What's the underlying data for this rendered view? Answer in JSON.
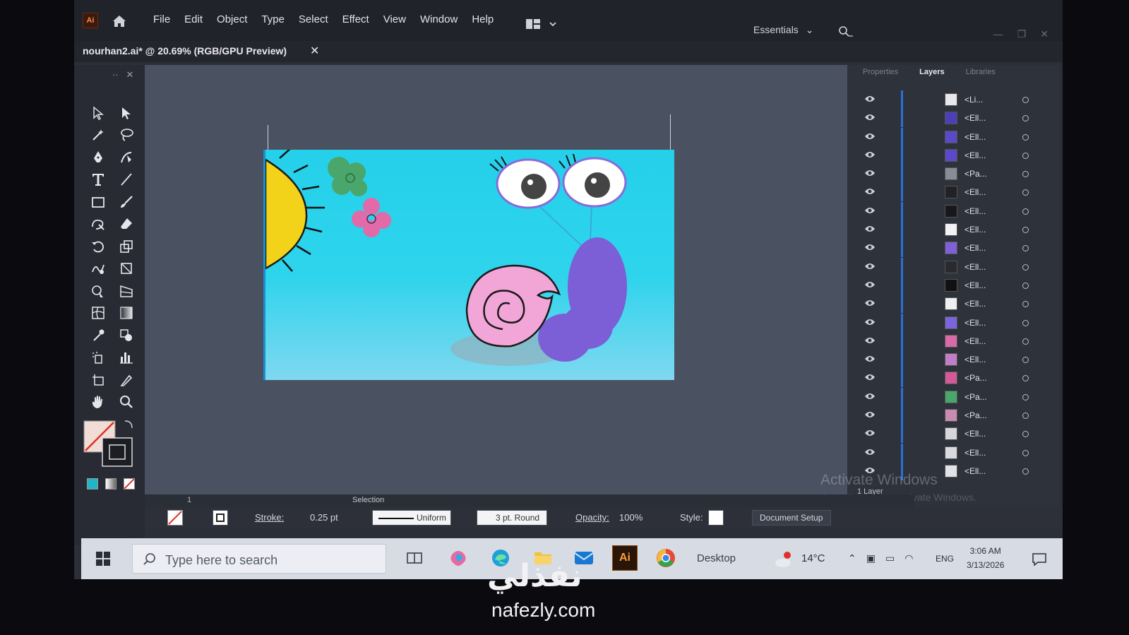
{
  "app": {
    "logo_text": "Ai",
    "menu": [
      "File",
      "Edit",
      "Object",
      "Type",
      "Select",
      "Effect",
      "View",
      "Window",
      "Help"
    ],
    "workspace": "Essentials"
  },
  "document": {
    "tab_title": "nourhan2.ai* @ 20.69% (RGB/GPU Preview)",
    "close_glyph": "✕"
  },
  "panel": {
    "tabs": [
      "Properties",
      "Layers",
      "Libraries"
    ],
    "active_tab": "Layers",
    "layers": [
      {
        "name": "<Li...",
        "thumb": "#e8e8ec"
      },
      {
        "name": "<Ell...",
        "thumb": "#4b3fb8"
      },
      {
        "name": "<Ell...",
        "thumb": "#5b49c9"
      },
      {
        "name": "<Ell...",
        "thumb": "#5b49c9"
      },
      {
        "name": "<Pa...",
        "thumb": "#888c96"
      },
      {
        "name": "<Ell...",
        "thumb": "#222226"
      },
      {
        "name": "<Ell...",
        "thumb": "#18181c"
      },
      {
        "name": "<Ell...",
        "thumb": "#f2f2f4"
      },
      {
        "name": "<Ell...",
        "thumb": "#8060d6"
      },
      {
        "name": "<Ell...",
        "thumb": "#2a2a2e"
      },
      {
        "name": "<Ell...",
        "thumb": "#111114"
      },
      {
        "name": "<Ell...",
        "thumb": "#f0f0f2"
      },
      {
        "name": "<Ell...",
        "thumb": "#7a66dc"
      },
      {
        "name": "<Ell...",
        "thumb": "#d96aa8"
      },
      {
        "name": "<Ell...",
        "thumb": "#c07ec6"
      },
      {
        "name": "<Pa...",
        "thumb": "#d35a98"
      },
      {
        "name": "<Pa...",
        "thumb": "#4aa66a"
      },
      {
        "name": "<Pa...",
        "thumb": "#c78cb0"
      },
      {
        "name": "<Ell...",
        "thumb": "#d6d6da"
      },
      {
        "name": "<Ell...",
        "thumb": "#dadade"
      },
      {
        "name": "<Ell...",
        "thumb": "#e2e2e6"
      }
    ],
    "layer_count": "1 Layer",
    "activate_title": "Activate Windows",
    "activate_sub": "Go to Settings to activate Windows."
  },
  "status": {
    "page": "1",
    "tool": "Selection"
  },
  "properties_bar": {
    "stroke_label": "Stroke:",
    "stroke_value": "0.25 pt",
    "profile": "Uniform",
    "brush": "3 pt. Round",
    "opacity_label": "Opacity:",
    "opacity_value": "100%",
    "style_label": "Style:",
    "document_setup": "Document Setup"
  },
  "taskbar": {
    "search_placeholder": "Type here to search",
    "ai_label": "Ai",
    "desktop": "Desktop",
    "temperature": "14°C",
    "language": "ENG",
    "time": "3:06 AM",
    "date": "3/13/2026"
  },
  "watermark": {
    "arabic": "نفذلي",
    "latin": "nafezly.com"
  }
}
